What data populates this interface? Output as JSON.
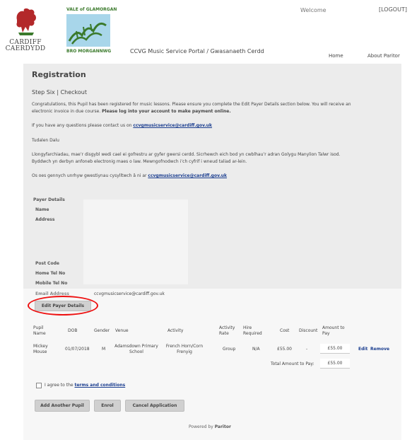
{
  "header": {
    "welcome": "Welcome",
    "logout": "[LOGOUT]",
    "cardiff_logo_text": [
      "CARDIFF",
      "CAERDYDD"
    ],
    "vale_logo_top": "VALE of GLAMORGAN",
    "vale_logo_bottom": "BRO MORGANNWG",
    "portal_title": "CCVG Music Service Portal / Gwasanaeth Cerdd",
    "nav": {
      "home": "Home",
      "about": "About Paritor"
    }
  },
  "registration": {
    "title": "Registration",
    "step": "Step Six | Checkout",
    "para1_line1": "Congratulations, this Pupil has been registered for music lessons. Please ensure you complete the Edit Payer Details section below. You will receive an",
    "para1_line2_prefix": "electronic invoice in due course. ",
    "para1_line2_bold": "Please log into your account to make payment online.",
    "contact_prefix": "If you have any questions please contact us on ",
    "contact_email": "ccvgmusicservice@cardiff.gov.uk",
    "tudalen": "Tudalen Dalu",
    "welsh_line1": "Llongyfarchiadau, mae’r disgybl wedi cael ei gofrestru ar gyfer gwersi cerdd. Sicrhewch eich bod yn cwblhau’r adran Golygu Manylion Talwr isod.",
    "welsh_line2": "Byddwch yn derbyn anfoneb electronig maes o law. Mewngofnodwch i’ch cyfrif i wneud taliad ar-lein.",
    "welsh_contact_prefix": "Os oes gennych unrhyw gwestiynau cysylltwch â ni ar ",
    "welsh_contact_email": "ccvgmusicservice@cardiff.gov.uk"
  },
  "payer": {
    "title": "Payer Details",
    "labels": [
      "Name",
      "Address",
      "Post Code",
      "Home Tel No",
      "Mobile Tel No",
      "Email Address"
    ],
    "email_value": "ccvgmusicservice@cardiff.gov.uk",
    "edit_button": "Edit Payer Details"
  },
  "table": {
    "headers": {
      "pupil": [
        "Pupil",
        "Name"
      ],
      "dob": "DOB",
      "gender": "Gender",
      "venue": "Venue",
      "activity": "Activity",
      "activity_rate": [
        "Activity",
        "Rate"
      ],
      "hire": [
        "Hire",
        "Required"
      ],
      "cost": "Cost",
      "discount": "Discount",
      "amount": [
        "Amount to",
        "Pay"
      ]
    },
    "row": {
      "pupil": [
        "Mickey",
        "Mouse"
      ],
      "dob": "01/07/2018",
      "gender": "M",
      "venue": [
        "Adamsdown Primary",
        "School"
      ],
      "activity": [
        "French Horn/Corn",
        "Frenyig"
      ],
      "activity_rate": "Group",
      "hire": "N/A",
      "cost": "£55.00",
      "discount": "-",
      "amount": "£55.00",
      "edit": "Edit",
      "remove": "Remove"
    },
    "total_label": "Total Amount to Pay:",
    "total_value": "£55.00"
  },
  "terms": {
    "prefix": "I agree to the ",
    "link": "terms and conditions"
  },
  "buttons": {
    "add_pupil": "Add Another Pupil",
    "enrol": "Enrol",
    "cancel": "Cancel Application"
  },
  "footer": {
    "prefix": "Powered by ",
    "brand": "Paritor"
  },
  "colors": {
    "link": "#1a3d8f",
    "highlight": "#ee1111",
    "content_bg": "#ececec"
  }
}
